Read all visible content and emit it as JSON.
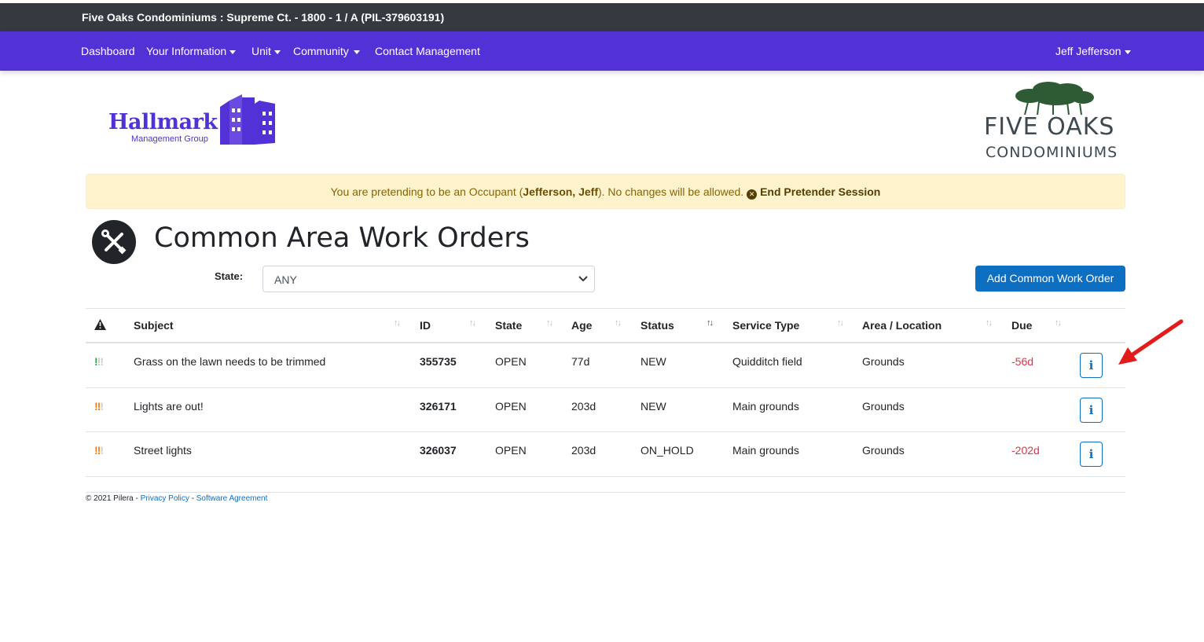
{
  "topbar": {
    "title": "Five Oaks Condominiums : Supreme Ct. - 1800 - 1 / A (PIL-379603191)"
  },
  "nav": {
    "items": [
      {
        "label": "Dashboard"
      },
      {
        "label": "Your Information"
      },
      {
        "label": "Unit"
      },
      {
        "label": "Community"
      },
      {
        "label": "Contact Management"
      }
    ],
    "user": "Jeff Jefferson"
  },
  "logos": {
    "left_name": "Hallmark",
    "left_sub": "Management Group",
    "right_name": "FIVE OAKS",
    "right_sub": "CONDOMINIUMS"
  },
  "alert": {
    "prefix": "You are pretending to be an Occupant (",
    "name": "Jefferson, Jeff",
    "suffix": "). No changes will be allowed.",
    "end_label": "End Pretender Session"
  },
  "page": {
    "title": "Common Area Work Orders"
  },
  "filter": {
    "state_label": "State:",
    "state_value": "ANY"
  },
  "add_button": "Add Common Work Order",
  "table": {
    "headers": [
      "Subject",
      "ID",
      "State",
      "Age",
      "Status",
      "Service Type",
      "Area / Location",
      "Due"
    ],
    "rows": [
      {
        "priority": "low",
        "subject": "Grass on the lawn needs to be trimmed",
        "id": "355735",
        "state": "OPEN",
        "age": "77d",
        "status": "NEW",
        "service_type": "Quidditch field",
        "area": "Grounds",
        "due": "-56d"
      },
      {
        "priority": "medium",
        "subject": "Lights are out!",
        "id": "326171",
        "state": "OPEN",
        "age": "203d",
        "status": "NEW",
        "service_type": "Main grounds",
        "area": "Grounds",
        "due": ""
      },
      {
        "priority": "medium",
        "subject": "Street lights",
        "id": "326037",
        "state": "OPEN",
        "age": "203d",
        "status": "ON_HOLD",
        "service_type": "Main grounds",
        "area": "Grounds",
        "due": "-202d"
      }
    ]
  },
  "footer": {
    "copyright": "© 2021 Pilera - ",
    "privacy": "Privacy Policy",
    "sep": " - ",
    "agreement": "Software Agreement"
  },
  "colors": {
    "brand": "#5231d6",
    "primary": "#0d6fc2",
    "danger": "#dc3545",
    "annotation": "#e31b1b"
  }
}
